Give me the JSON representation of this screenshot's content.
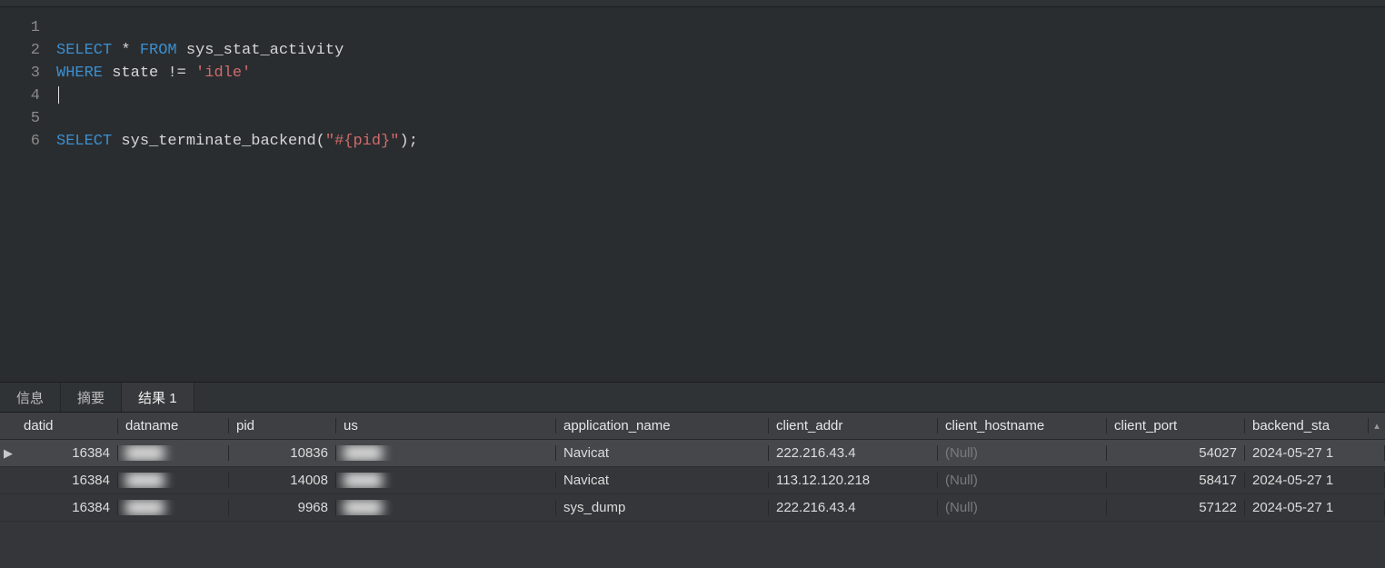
{
  "editor": {
    "lines": [
      {
        "n": 1,
        "tokens": []
      },
      {
        "n": 2,
        "tokens": [
          {
            "t": "SELECT",
            "c": "kw"
          },
          {
            "t": " ",
            "c": "sp"
          },
          {
            "t": "*",
            "c": "star"
          },
          {
            "t": " ",
            "c": "sp"
          },
          {
            "t": "FROM",
            "c": "kw"
          },
          {
            "t": " ",
            "c": "sp"
          },
          {
            "t": "sys_stat_activity",
            "c": "ident"
          }
        ]
      },
      {
        "n": 3,
        "tokens": [
          {
            "t": "WHERE",
            "c": "kw"
          },
          {
            "t": " ",
            "c": "sp"
          },
          {
            "t": "state",
            "c": "ident"
          },
          {
            "t": " ",
            "c": "sp"
          },
          {
            "t": "!=",
            "c": "op"
          },
          {
            "t": " ",
            "c": "sp"
          },
          {
            "t": "'idle'",
            "c": "str"
          }
        ]
      },
      {
        "n": 4,
        "tokens": [],
        "cursor": true
      },
      {
        "n": 5,
        "tokens": []
      },
      {
        "n": 6,
        "tokens": [
          {
            "t": "SELECT",
            "c": "kw"
          },
          {
            "t": " ",
            "c": "sp"
          },
          {
            "t": "sys_terminate_backend",
            "c": "ident"
          },
          {
            "t": "(",
            "c": "op"
          },
          {
            "t": "\"#{pid}\"",
            "c": "str"
          },
          {
            "t": ")",
            "c": "op"
          },
          {
            "t": ";",
            "c": "op"
          }
        ]
      }
    ]
  },
  "tabs": {
    "items": [
      {
        "label": "信息",
        "active": false
      },
      {
        "label": "摘要",
        "active": false
      },
      {
        "label": "结果 1",
        "active": true
      }
    ]
  },
  "results": {
    "columns": [
      {
        "key": "datid",
        "label": "datid",
        "cls": "c-datid",
        "align": "num"
      },
      {
        "key": "datname",
        "label": "datname",
        "cls": "c-datname",
        "align": ""
      },
      {
        "key": "pid",
        "label": "pid",
        "cls": "c-pid",
        "align": "num"
      },
      {
        "key": "us",
        "label": "us",
        "cls": "c-us",
        "align": ""
      },
      {
        "key": "application_name",
        "label": "application_name",
        "cls": "c-app",
        "align": ""
      },
      {
        "key": "client_addr",
        "label": "client_addr",
        "cls": "c-addr",
        "align": ""
      },
      {
        "key": "client_hostname",
        "label": "client_hostname",
        "cls": "c-host",
        "align": ""
      },
      {
        "key": "client_port",
        "label": "client_port",
        "cls": "c-port",
        "align": "num"
      },
      {
        "key": "backend_start",
        "label": "backend_sta",
        "cls": "c-back",
        "align": ""
      }
    ],
    "null_text": "(Null)",
    "rows": [
      {
        "selected": true,
        "datid": "16384",
        "datname": {
          "blurred": true
        },
        "pid": "10836",
        "us": {
          "blurred": true
        },
        "application_name": "Navicat",
        "client_addr": "222.216.43.4",
        "client_hostname": null,
        "client_port": "54027",
        "backend_start": "2024-05-27 1"
      },
      {
        "selected": false,
        "datid": "16384",
        "datname": {
          "blurred": true
        },
        "pid": "14008",
        "us": {
          "blurred": true
        },
        "application_name": "Navicat",
        "client_addr": "113.12.120.218",
        "client_hostname": null,
        "client_port": "58417",
        "backend_start": "2024-05-27 1"
      },
      {
        "selected": false,
        "datid": "16384",
        "datname": {
          "blurred": true
        },
        "pid": "9968",
        "us": {
          "blurred": true
        },
        "application_name": "sys_dump",
        "client_addr": "222.216.43.4",
        "client_hostname": null,
        "client_port": "57122",
        "backend_start": "2024-05-27 1"
      }
    ]
  }
}
